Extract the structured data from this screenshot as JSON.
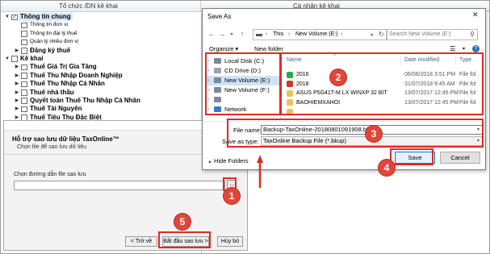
{
  "app": {
    "col_left": "Tổ chức /DN kê khai",
    "col_right": "Cá nhân kê khai",
    "tree": [
      {
        "label": "Thông tin chung",
        "level": 0,
        "bold": true,
        "checked": true,
        "toggle": "▼",
        "selected": true
      },
      {
        "label": "Thông tin đơn vị",
        "level": 1,
        "bold": false,
        "checked": false,
        "toggle": ""
      },
      {
        "label": "Thông tin đại lý thuế",
        "level": 1,
        "bold": false,
        "checked": false,
        "toggle": ""
      },
      {
        "label": "Quản lý nhiều đơn vị",
        "level": 1,
        "bold": false,
        "checked": false,
        "toggle": ""
      },
      {
        "label": "Đăng ký thuế",
        "level": 1,
        "bold": true,
        "checked": false,
        "toggle": "▶"
      },
      {
        "label": "Kê khai",
        "level": 0,
        "bold": true,
        "checked": false,
        "toggle": "▼"
      },
      {
        "label": "Thuế Giá Trị Gia Tăng",
        "level": 1,
        "bold": true,
        "checked": false,
        "toggle": "▶"
      },
      {
        "label": "Thuế Thu Nhập Doanh Nghiệp",
        "level": 1,
        "bold": true,
        "checked": false,
        "toggle": "▶"
      },
      {
        "label": "Thuế Thu Nhập Cá Nhân",
        "level": 1,
        "bold": true,
        "checked": false,
        "toggle": "▶"
      },
      {
        "label": "Thuế nhà thầu",
        "level": 1,
        "bold": true,
        "checked": false,
        "toggle": "▶"
      },
      {
        "label": "Quyết toán Thuế Thu Nhập Cá Nhân",
        "level": 1,
        "bold": true,
        "checked": false,
        "toggle": "▶"
      },
      {
        "label": "Thuế Tài Nguyên",
        "level": 1,
        "bold": true,
        "checked": false,
        "toggle": "▶"
      },
      {
        "label": "Thuế Tiêu Thụ Đặc Biệt",
        "level": 1,
        "bold": true,
        "checked": false,
        "toggle": "▶"
      }
    ]
  },
  "backup_dialog": {
    "title": "Hỗ trợ sao lưu dữ liệu TaxOnline™",
    "subtitle": "Chọn file để sao lưu dữ liệu",
    "path_label": "Chọn đường dẫn file sao lưu",
    "path_value": "",
    "browse_label": "...",
    "back_label": "< Trở về",
    "start_label": "Bắt đầu sao lưu >",
    "cancel_label": "Hủy bỏ"
  },
  "save_as": {
    "title": "Save As",
    "close_label": "✕",
    "address": {
      "this_pc": "This",
      "sep": "›",
      "location": "New Volume (E:)"
    },
    "search_placeholder": "Search New Volume (E:)",
    "organize_label": "Organize ▾",
    "new_folder_label": "New folder",
    "nav_items": [
      {
        "label": "Local Disk (C:)",
        "color": "#7a8a9c",
        "selected": false
      },
      {
        "label": "CD Drive (D:)",
        "color": "#9aa4ad",
        "selected": false
      },
      {
        "label": "New Volume (E:)",
        "color": "#7a8a9c",
        "selected": true
      },
      {
        "label": "New Volume (F:)",
        "color": "#7a8a9c",
        "selected": false
      },
      {
        "label": "",
        "color": "#7a8a9c",
        "selected": false
      },
      {
        "label": "Network",
        "color": "#3c78c8",
        "selected": false
      }
    ],
    "columns": {
      "name": "Name",
      "date": "Date modified",
      "type": "Type"
    },
    "files": [
      {
        "name": "2016",
        "date": "06/06/2018 3:51 PM",
        "type": "File fol",
        "icon_color": "#2fa84f"
      },
      {
        "name": "2018",
        "date": "31/07/2018 9:45 AM",
        "type": "File fol",
        "icon_color": "#d9342b"
      },
      {
        "name": "ASUS P5G41T-M LX WINXP 32 BIT",
        "date": "13/07/2017 12:45 PM",
        "type": "File fol",
        "icon_color": "#e9c35a"
      },
      {
        "name": "BAOHIEMXAHOI",
        "date": "13/07/2017 12:45 PM",
        "type": "File fol",
        "icon_color": "#e9c35a"
      },
      {
        "name": "",
        "date": "",
        "type": "",
        "icon_color": "#e9c35a"
      }
    ],
    "file_name_label": "File name:",
    "file_name_value": "Backup-TaxOnline-20180801091908.bkup",
    "save_type_label": "Save as type:",
    "save_type_value": "TaxOnline Backup File (*.bkup)",
    "hide_folders_label": "Hide Folders",
    "save_label": "Save",
    "cancel_label": "Cancel"
  },
  "steps": [
    "1",
    "2",
    "3",
    "4",
    "5"
  ],
  "accent_color": "#e02a22"
}
